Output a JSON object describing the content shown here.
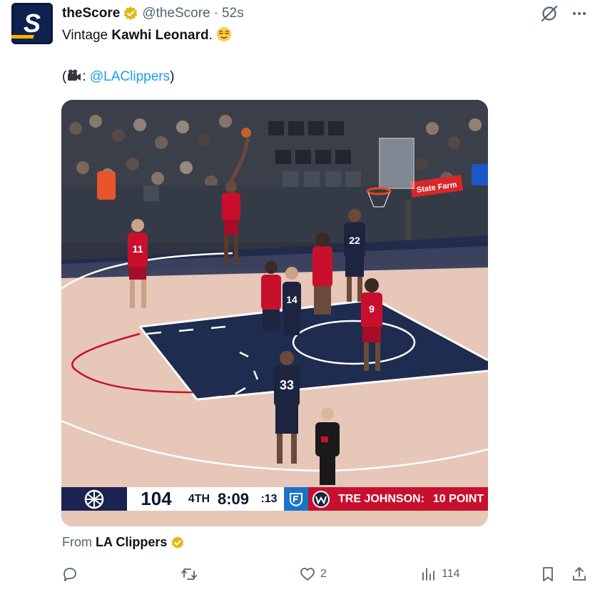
{
  "account": {
    "name": "theScore",
    "handle": "@theScore",
    "separator": "·",
    "time": "52s",
    "avatar_letter": "S"
  },
  "post": {
    "text_prefix": "Vintage ",
    "text_bold": "Kawhi Leonard",
    "text_suffix": ".",
    "emoji_name": "relieved-face-emoji",
    "credit_open": "(",
    "credit_icon": "camera-emoji",
    "credit_colon": ": ",
    "credit_link": "@LAClippers",
    "credit_close": ")"
  },
  "scoreboard": {
    "score": "104",
    "quarter": "4TH",
    "clock": "8:09",
    "shot_clock": ":13",
    "ticker_label": "TRE JOHNSON:",
    "ticker_value": "10 POINT",
    "arena_sign": "State Farm",
    "jersey_numbers": [
      "33",
      "22",
      "14",
      "9",
      "11"
    ]
  },
  "source": {
    "prefix": "From",
    "name": "LA Clippers"
  },
  "actions": {
    "reply_count": "",
    "repost_count": "",
    "like_count": "2",
    "views_count": "114"
  },
  "colors": {
    "link": "#1d9bf0",
    "verified_gold": "#e2b719",
    "secondary_text": "#536471",
    "wizards_red": "#c8102e",
    "clippers_navy": "#1b2350"
  }
}
